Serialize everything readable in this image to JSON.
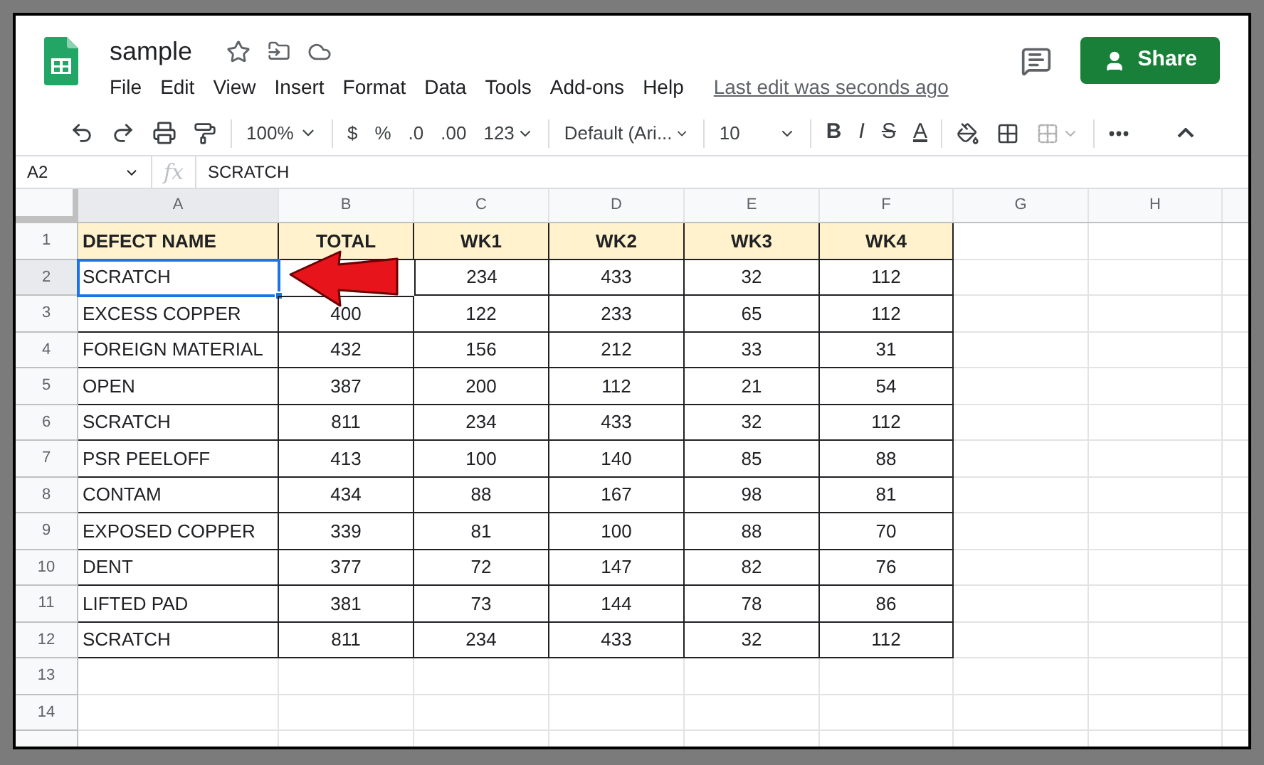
{
  "document": {
    "title": "sample"
  },
  "menu": [
    "File",
    "Edit",
    "View",
    "Insert",
    "Format",
    "Data",
    "Tools",
    "Add-ons",
    "Help"
  ],
  "last_edit": "Last edit was seconds ago",
  "share_button": "Share",
  "toolbar": {
    "zoom": "100%",
    "currency": "$",
    "percent": "%",
    "decrease_decimals": ".0",
    "increase_decimals": ".00",
    "number_format": "123",
    "font": "Default (Ari...",
    "font_size": "10",
    "bold": "B",
    "italic": "I",
    "strikethrough": "S",
    "text_color": "A",
    "merge_disabled": true
  },
  "formula_bar": {
    "cell": "A2",
    "fx": "fx",
    "value": "SCRATCH"
  },
  "columns": [
    {
      "label": "A",
      "selected": true
    },
    {
      "label": "B",
      "selected": false
    },
    {
      "label": "C",
      "selected": false
    },
    {
      "label": "D",
      "selected": false
    },
    {
      "label": "E",
      "selected": false
    },
    {
      "label": "F",
      "selected": false
    },
    {
      "label": "G",
      "selected": false
    },
    {
      "label": "H",
      "selected": false
    }
  ],
  "rows": [
    {
      "number": "1",
      "kind": "header",
      "selected": false,
      "cells": [
        "DEFECT NAME",
        "TOTAL",
        "WK1",
        "WK2",
        "WK3",
        "WK4"
      ]
    },
    {
      "number": "2",
      "kind": "data",
      "selected": true,
      "cells": [
        "SCRATCH",
        null,
        "234",
        "433",
        "32",
        "112"
      ]
    },
    {
      "number": "3",
      "kind": "data",
      "selected": false,
      "cells": [
        "EXCESS COPPER",
        "400",
        "122",
        "233",
        "65",
        "112"
      ]
    },
    {
      "number": "4",
      "kind": "data",
      "selected": false,
      "cells": [
        "FOREIGN MATERIAL",
        "432",
        "156",
        "212",
        "33",
        "31"
      ]
    },
    {
      "number": "5",
      "kind": "data",
      "selected": false,
      "cells": [
        "OPEN",
        "387",
        "200",
        "112",
        "21",
        "54"
      ]
    },
    {
      "number": "6",
      "kind": "data",
      "selected": false,
      "cells": [
        "SCRATCH",
        "811",
        "234",
        "433",
        "32",
        "112"
      ]
    },
    {
      "number": "7",
      "kind": "data",
      "selected": false,
      "cells": [
        "PSR PEELOFF",
        "413",
        "100",
        "140",
        "85",
        "88"
      ]
    },
    {
      "number": "8",
      "kind": "data",
      "selected": false,
      "cells": [
        "CONTAM",
        "434",
        "88",
        "167",
        "98",
        "81"
      ]
    },
    {
      "number": "9",
      "kind": "data",
      "selected": false,
      "cells": [
        "EXPOSED COPPER",
        "339",
        "81",
        "100",
        "88",
        "70"
      ]
    },
    {
      "number": "10",
      "kind": "data",
      "selected": false,
      "cells": [
        "DENT",
        "377",
        "72",
        "147",
        "82",
        "76"
      ]
    },
    {
      "number": "11",
      "kind": "data",
      "selected": false,
      "cells": [
        "LIFTED PAD",
        "381",
        "73",
        "144",
        "78",
        "86"
      ]
    },
    {
      "number": "12",
      "kind": "data",
      "selected": false,
      "cells": [
        "SCRATCH",
        "811",
        "234",
        "433",
        "32",
        "112"
      ]
    },
    {
      "number": "13",
      "kind": "empty",
      "selected": false
    },
    {
      "number": "14",
      "kind": "empty",
      "selected": false
    }
  ]
}
